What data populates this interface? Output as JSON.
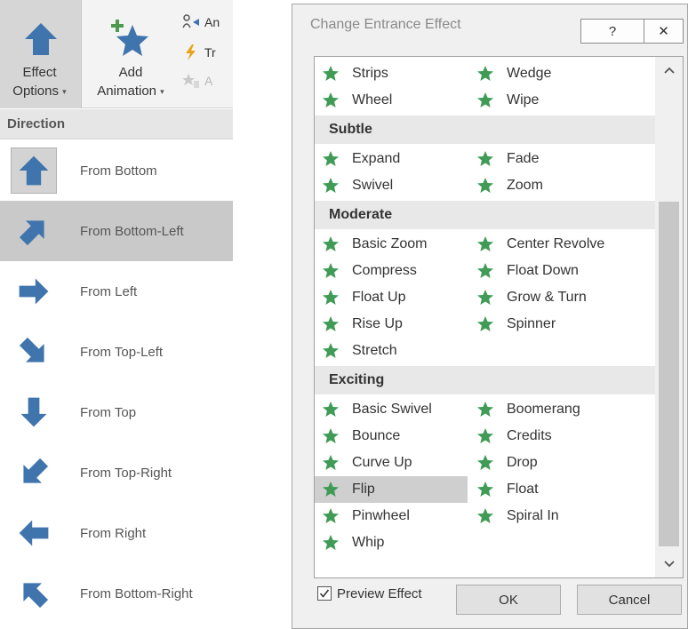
{
  "ribbon": {
    "effect_options_line1": "Effect",
    "effect_options_line2": "Options",
    "add_animation_line1": "Add",
    "add_animation_line2": "Animation",
    "mini_items": [
      "An",
      "Tr",
      "A"
    ]
  },
  "direction": {
    "header": "Direction",
    "items": [
      {
        "label": "From Bottom",
        "icon": "arrow-up-icon",
        "checked": true
      },
      {
        "label": "From Bottom-Left",
        "icon": "arrow-up-right-icon",
        "selected": true
      },
      {
        "label": "From Left",
        "icon": "arrow-right-icon"
      },
      {
        "label": "From Top-Left",
        "icon": "arrow-down-right-icon"
      },
      {
        "label": "From Top",
        "icon": "arrow-down-icon"
      },
      {
        "label": "From Top-Right",
        "icon": "arrow-down-left-icon"
      },
      {
        "label": "From Right",
        "icon": "arrow-left-icon"
      },
      {
        "label": "From Bottom-Right",
        "icon": "arrow-up-left-icon"
      }
    ]
  },
  "dialog": {
    "title": "Change Entrance Effect",
    "help_label": "?",
    "close_label": "✕",
    "preview_label": "Preview Effect",
    "preview_checked": true,
    "ok_label": "OK",
    "cancel_label": "Cancel"
  },
  "effects": {
    "top": [
      "Strips",
      "Wedge",
      "Wheel",
      "Wipe"
    ],
    "categories": [
      {
        "name": "Subtle",
        "items": [
          "Expand",
          "Fade",
          "Swivel",
          "Zoom"
        ]
      },
      {
        "name": "Moderate",
        "items": [
          "Basic Zoom",
          "Center Revolve",
          "Compress",
          "Float Down",
          "Float Up",
          "Grow & Turn",
          "Rise Up",
          "Spinner",
          "Stretch"
        ]
      },
      {
        "name": "Exciting",
        "items": [
          "Basic Swivel",
          "Boomerang",
          "Bounce",
          "Credits",
          "Curve Up",
          "Drop",
          "Flip",
          "Float",
          "Pinwheel",
          "Spiral In",
          "Whip"
        ]
      }
    ],
    "selected": "Flip"
  },
  "colors": {
    "arrow_blue": "#3f74ad",
    "star_green": "#3f9b55",
    "ribbon_selected": "#d6d6d6",
    "list_selected": "#cfcfcf"
  }
}
